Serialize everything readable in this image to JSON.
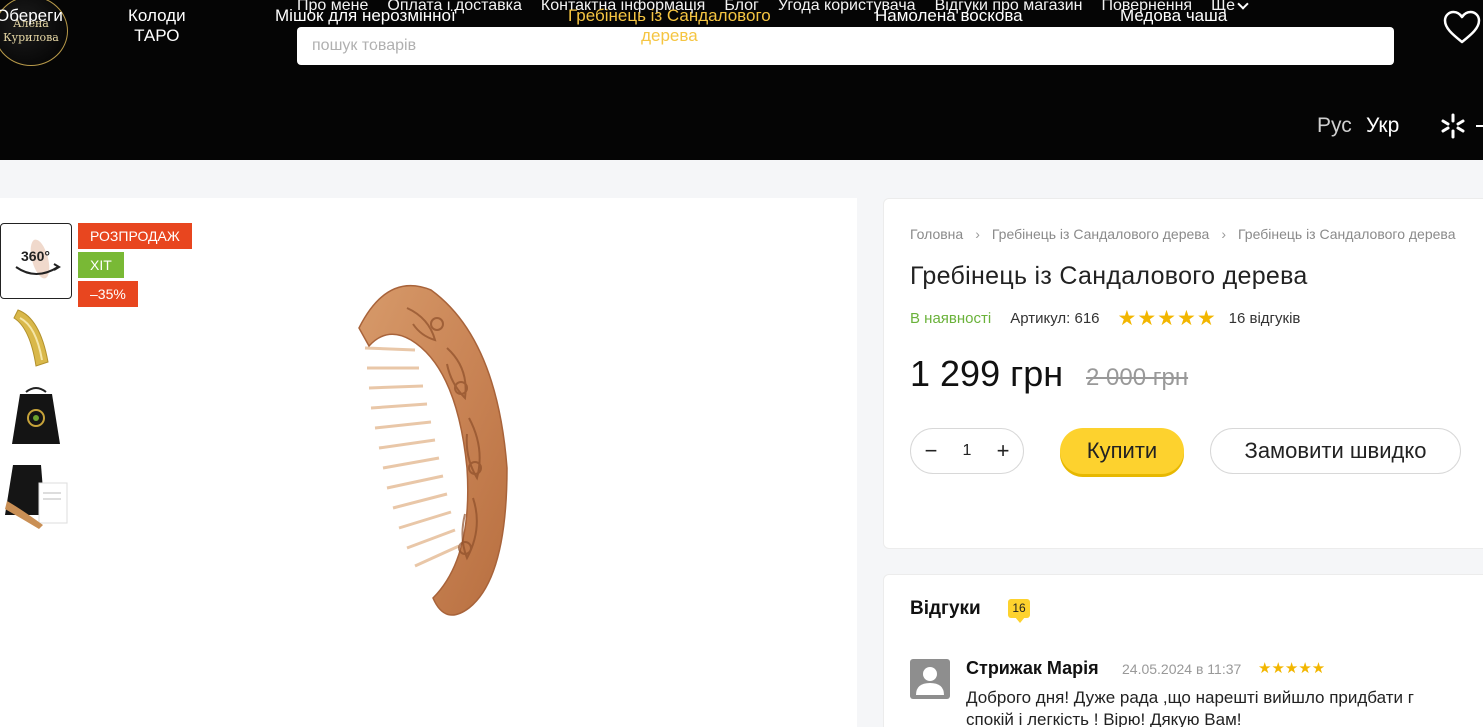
{
  "header": {
    "logo_text": "Алена\nКурилова",
    "top_links": [
      "Про мене",
      "Оплата і доставка",
      "Контактна інформація",
      "Блог",
      "Угода користувача",
      "Відгуки про магазин",
      "Повернення"
    ],
    "more_label": "Ще",
    "search_placeholder": "пошук товарів"
  },
  "categories": [
    {
      "label": "Обереги",
      "active": false
    },
    {
      "label": "Колоди\nТАРО",
      "active": false
    },
    {
      "label": "Мішок для нерозмінної\nкупюри",
      "active": false
    },
    {
      "label": "Гребінець із Сандалового\nдерева",
      "active": true
    },
    {
      "label": "Намолена воскова\nсвічка",
      "active": false
    },
    {
      "label": "Медова чаша\nуспіху",
      "active": false
    }
  ],
  "languages": {
    "ru": "Рус",
    "uk": "Укр"
  },
  "gallery": {
    "thumb_360_label": "360°",
    "badges": {
      "sale": "РОЗПРОДАЖ",
      "hit": "ХІТ",
      "discount": "–35%"
    }
  },
  "product": {
    "breadcrumbs": [
      "Головна",
      "Гребінець із Сандалового дерева",
      "Гребінець із Сандалового дерева"
    ],
    "title": "Гребінець із Сандалового дерева",
    "stock": "В наявності",
    "sku": "Артикул: 616",
    "rating_stars": "★★★★★",
    "review_count": "16 відгуків",
    "price": "1 299 грн",
    "old_price": "2 000 грн",
    "quantity": "1",
    "qty_minus": "−",
    "qty_plus": "+",
    "buy_label": "Купити",
    "quick_order_label": "Замовити швидко"
  },
  "reviews": {
    "title": "Відгуки",
    "count": "16",
    "items": [
      {
        "author": "Стрижак Марія",
        "date": "24.05.2024 в 11:37",
        "stars": "★★★★★",
        "text": "Доброго дня! Дуже рада ,що нарешті вийшло придбати г\nспокій і легкість ! Вірю! Дякую Вам!"
      }
    ]
  },
  "colors": {
    "header_bg": "#050505",
    "accent_gold": "#f5c542",
    "buy_yellow": "#fdd22e",
    "sale_red": "#e8461f",
    "hit_green": "#79b935",
    "stock_green": "#6ab23a",
    "star": "#f2b600"
  }
}
